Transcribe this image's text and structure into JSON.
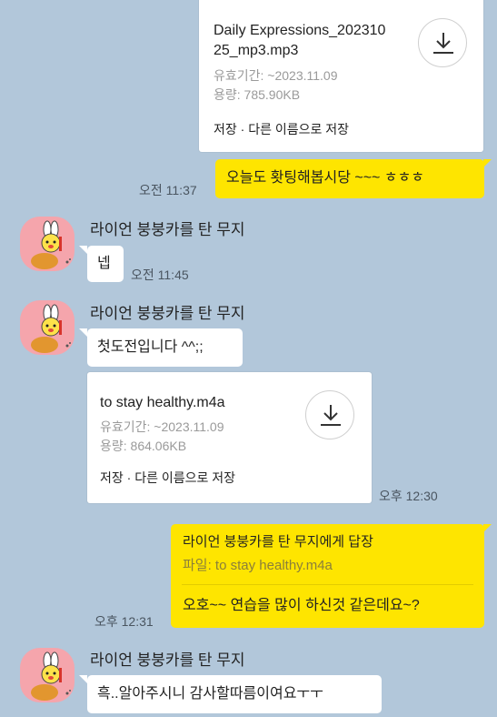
{
  "file1": {
    "name_line1": "Daily Expressions_202310",
    "name_line2": "25_mp3.mp3",
    "validity": "유효기간: ~2023.11.09",
    "size": "용량: 785.90KB",
    "actions": "저장 · 다른 이름으로 저장"
  },
  "msg_mine1": {
    "time": "오전 11:37",
    "text": "오늘도 홧팅해봅시당 ~~~ ㅎㅎㅎ"
  },
  "group1": {
    "sender": "라이언 붕붕카를 탄 무지",
    "text": "넵",
    "time": "오전 11:45"
  },
  "group2": {
    "sender": "라이언 붕붕카를 탄 무지",
    "text": "첫도전입니다 ^^;;",
    "file": {
      "name": "to stay healthy.m4a",
      "validity": "유효기간: ~2023.11.09",
      "size": "용량: 864.06KB",
      "actions": "저장 · 다른 이름으로 저장"
    },
    "time": "오후 12:30"
  },
  "reply": {
    "time": "오후 12:31",
    "reply_to": "라이언 붕붕카를 탄 무지에게 답장",
    "quoted": "파일: to stay healthy.m4a",
    "text": "오호~~ 연습을 많이 하신것 같은데요~?"
  },
  "group3": {
    "sender": "라이언 붕붕카를 탄 무지",
    "text": "흑..알아주시니 감사할따름이여요ㅜㅜ"
  },
  "icons": {
    "download": "download-icon",
    "avatar": "ryan-muzi-avatar-icon"
  },
  "colors": {
    "background": "#b2c7da",
    "mine_bubble": "#fee500",
    "other_bubble": "#ffffff"
  }
}
